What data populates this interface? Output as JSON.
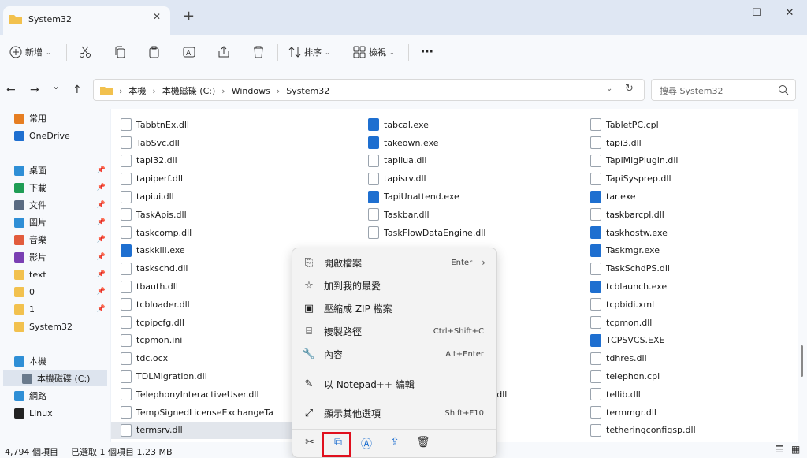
{
  "tab": {
    "title": "System32",
    "close": "✕",
    "new": "+"
  },
  "window": {
    "minimize": "—",
    "maximize": "☐",
    "close": "✕"
  },
  "toolbar": {
    "new_label": "新增",
    "sort_label": "排序",
    "view_label": "檢視",
    "more": "···"
  },
  "nav": {
    "back": "←",
    "forward": "→",
    "down": "⌄",
    "up": "↑"
  },
  "address": {
    "crumbs": [
      "本機",
      "本機磁碟 (C:)",
      "Windows",
      "System32"
    ],
    "refresh": "↻"
  },
  "search": {
    "placeholder": "搜尋 System32"
  },
  "sidebar": {
    "items": [
      {
        "label": "常用",
        "icon": "home-icon"
      },
      {
        "label": "OneDrive",
        "icon": "cloud-icon"
      },
      {
        "label": "桌面",
        "icon": "desktop-icon",
        "pin": true
      },
      {
        "label": "下載",
        "icon": "download-icon",
        "pin": true
      },
      {
        "label": "文件",
        "icon": "documents-icon",
        "pin": true
      },
      {
        "label": "圖片",
        "icon": "pictures-icon",
        "pin": true
      },
      {
        "label": "音樂",
        "icon": "music-icon",
        "pin": true
      },
      {
        "label": "影片",
        "icon": "videos-icon",
        "pin": true
      },
      {
        "label": "text",
        "icon": "folder-icon",
        "pin": true
      },
      {
        "label": "0",
        "icon": "folder-icon",
        "pin": true
      },
      {
        "label": "1",
        "icon": "folder-icon",
        "pin": true
      },
      {
        "label": "System32",
        "icon": "folder-icon"
      },
      {
        "label": "本機",
        "icon": "pc-icon"
      },
      {
        "label": "本機磁碟 (C:)",
        "icon": "drive-icon"
      },
      {
        "label": "網路",
        "icon": "network-icon"
      },
      {
        "label": "Linux",
        "icon": "linux-icon"
      }
    ]
  },
  "files": {
    "col1": [
      "TabbtnEx.dll",
      "TabSvc.dll",
      "tapi32.dll",
      "tapiperf.dll",
      "tapiui.dll",
      "TaskApis.dll",
      "taskcomp.dll",
      "taskkill.exe",
      "taskschd.dll",
      "tbauth.dll",
      "tcbloader.dll",
      "tcpipcfg.dll",
      "tcpmon.ini",
      "tdc.ocx",
      "TDLMigration.dll",
      "TelephonyInteractiveUser.dll",
      "TempSignedLicenseExchangeTa",
      "termsrv.dll"
    ],
    "col2": [
      "tabcal.exe",
      "takeown.exe",
      "tapilua.dll",
      "tapisrv.dll",
      "TapiUnattend.exe",
      "Taskbar.dll",
      "TaskFlowDataEngine.dll"
    ],
    "col2_partial": "s.dll",
    "col3": [
      "TabletPC.cpl",
      "tapi3.dll",
      "TapiMigPlugin.dll",
      "TapiSysprep.dll",
      "tar.exe",
      "taskbarcpl.dll",
      "taskhostw.exe",
      "Taskmgr.exe",
      "TaskSchdPS.dll",
      "tcblaunch.exe",
      "tcpbidi.xml",
      "tcpmon.dll",
      "TCPSVCS.EXE",
      "tdhres.dll",
      "telephon.cpl",
      "tellib.dll",
      "termmgr.dll",
      "tetheringconfigsp.dll"
    ]
  },
  "context_menu": {
    "items": [
      {
        "label": "開啟檔案",
        "shortcut": "Enter",
        "icon": "open-icon"
      },
      {
        "label": "加到我的最愛",
        "shortcut": "",
        "icon": "star-icon"
      },
      {
        "label": "壓縮成 ZIP 檔案",
        "shortcut": "",
        "icon": "zip-icon"
      },
      {
        "label": "複製路徑",
        "shortcut": "Ctrl+Shift+C",
        "icon": "copy-path-icon"
      },
      {
        "label": "內容",
        "shortcut": "Alt+Enter",
        "icon": "properties-icon"
      },
      {
        "label": "以 Notepad++ 編輯",
        "shortcut": "",
        "icon": "notepadpp-icon"
      },
      {
        "label": "顯示其他選項",
        "shortcut": "Shift+F10",
        "icon": "more-options-icon"
      }
    ]
  },
  "status": {
    "count": "4,794 個項目",
    "selected": "已選取 1 個項目 1.23 MB"
  }
}
